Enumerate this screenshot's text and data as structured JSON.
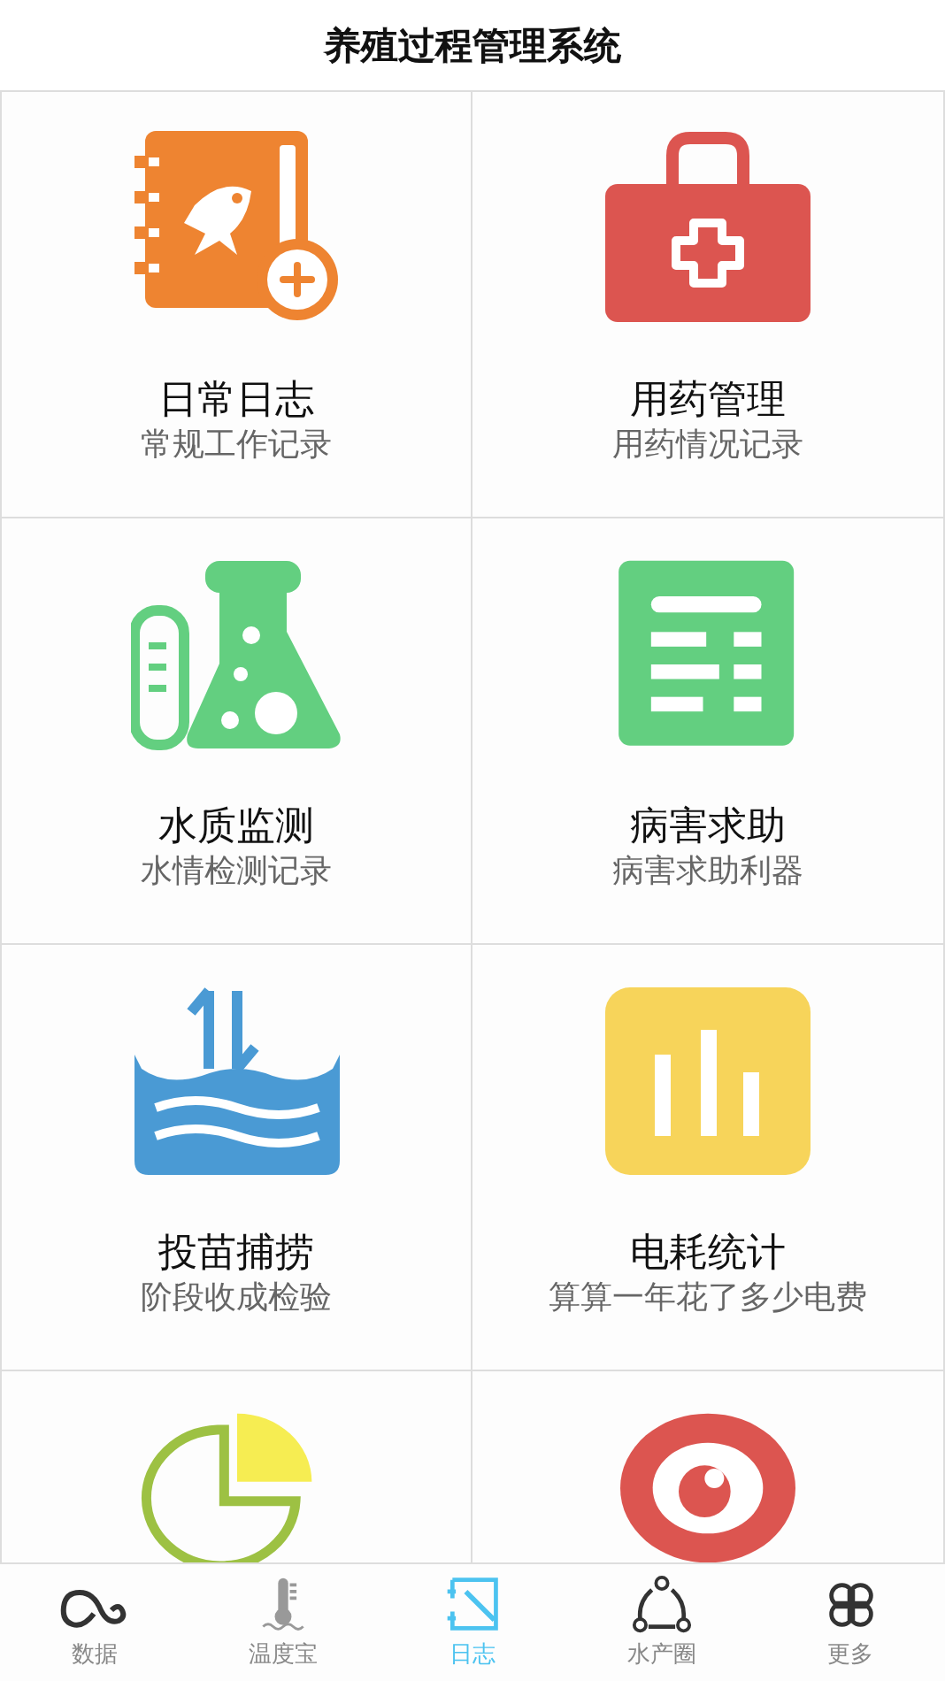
{
  "header": {
    "title": "养殖过程管理系统"
  },
  "tiles": [
    {
      "title": "日常日志",
      "subtitle": "常规工作记录"
    },
    {
      "title": "用药管理",
      "subtitle": "用药情况记录"
    },
    {
      "title": "水质监测",
      "subtitle": "水情检测记录"
    },
    {
      "title": "病害求助",
      "subtitle": "病害求助利器"
    },
    {
      "title": "投苗捕捞",
      "subtitle": "阶段收成检验"
    },
    {
      "title": "电耗统计",
      "subtitle": "算算一年花了多少电费"
    }
  ],
  "tab_bar": [
    {
      "label": "数据",
      "selected": false
    },
    {
      "label": "温度宝",
      "selected": false
    },
    {
      "label": "日志",
      "selected": true
    },
    {
      "label": "水产圈",
      "selected": false
    },
    {
      "label": "更多",
      "selected": false
    }
  ]
}
